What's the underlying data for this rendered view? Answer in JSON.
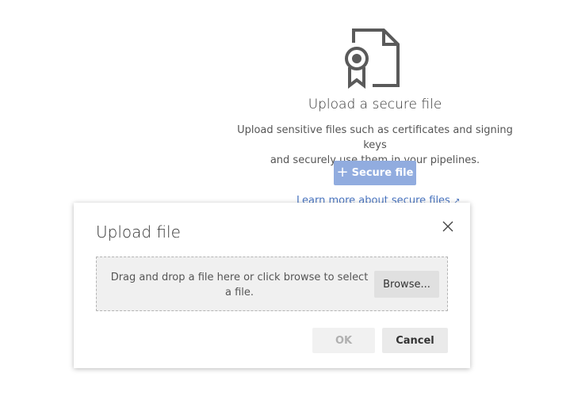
{
  "empty_state": {
    "illustration_icon": "secure-file-certificate-icon",
    "title": "Upload a secure file",
    "description_line1": "Upload sensitive files such as certificates and signing keys",
    "description_line2": "and securely use them in your pipelines.",
    "primary_button": {
      "icon": "plus-icon",
      "label": "Secure file"
    },
    "learn_more_link": "Learn more about secure files",
    "learn_more_icon": "external-link-icon"
  },
  "dialog": {
    "title": "Upload file",
    "close_icon": "close-icon",
    "dropzone_text": "Drag and drop a file here or click browse to select a file.",
    "browse_label": "Browse...",
    "ok_label": "OK",
    "cancel_label": "Cancel"
  },
  "colors": {
    "primary_button_bg": "#91acdf",
    "link": "#4a75c0",
    "icon_gray": "#555555",
    "disabled_text": "#b0b0b0"
  }
}
